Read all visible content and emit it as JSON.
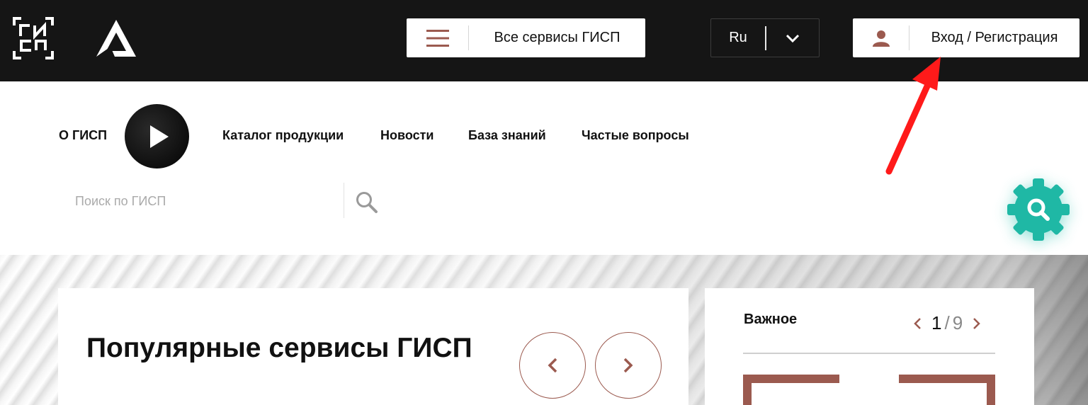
{
  "header": {
    "logo_text": "ГИСП",
    "services_button": "Все сервисы ГИСП",
    "language": "Ru",
    "login_button": "Вход / Регистрация"
  },
  "nav": {
    "items": [
      {
        "label": "О ГИСП"
      },
      {
        "label": "Каталог продукции"
      },
      {
        "label": "Новости"
      },
      {
        "label": "База знаний"
      },
      {
        "label": "Частые вопросы"
      }
    ]
  },
  "search": {
    "placeholder": "Поиск по ГИСП",
    "value": ""
  },
  "popular": {
    "title": "Популярные сервисы ГИСП"
  },
  "important": {
    "title": "Важное",
    "current_page": "1",
    "separator": "/",
    "total_pages": "9"
  },
  "colors": {
    "header_bg": "#151515",
    "accent_brown": "#9b5a4f",
    "fab_teal": "#1fb8a5",
    "annotation_red": "#ff1a1a"
  },
  "icons": {
    "menu": "hamburger-icon",
    "language_toggle": "chevron-down-icon",
    "login": "user-icon",
    "search": "search-icon",
    "video": "play-icon",
    "floating_search": "gear-search-icon"
  }
}
